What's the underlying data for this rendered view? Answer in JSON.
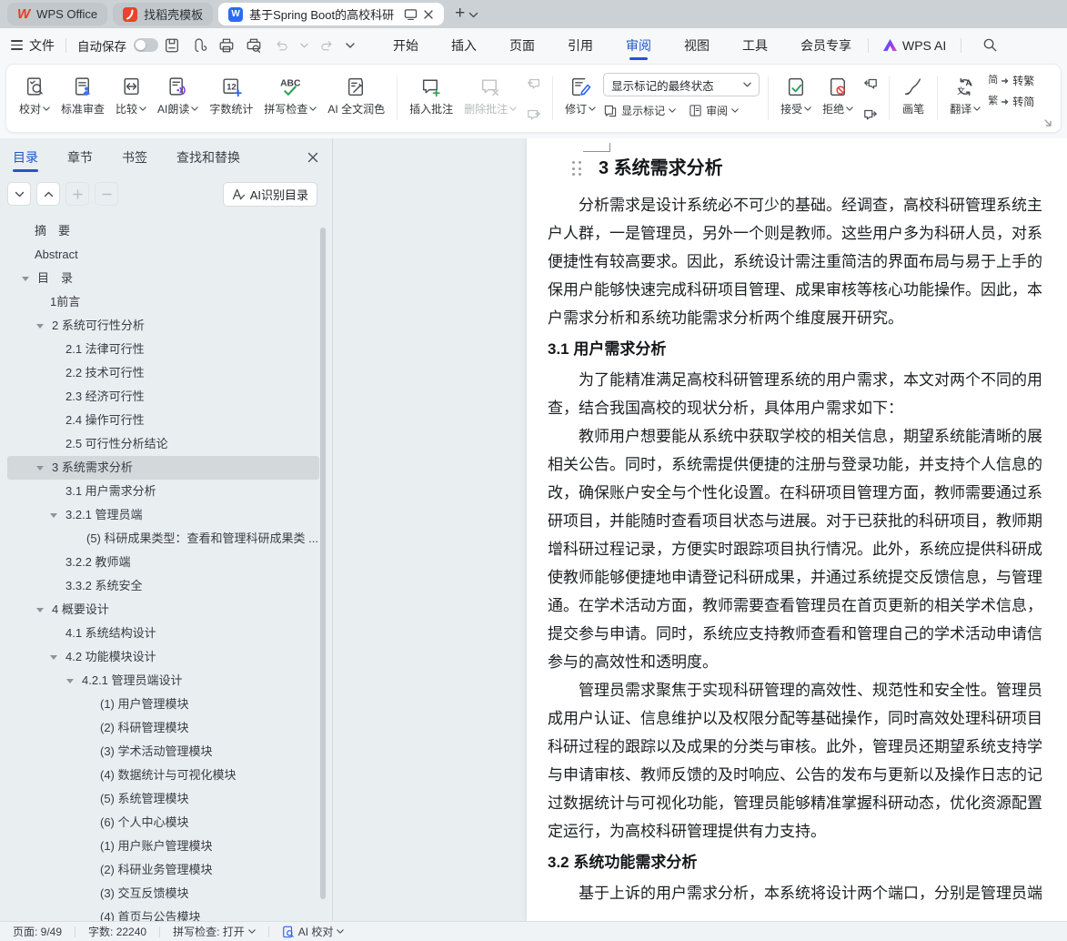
{
  "tabbar": {
    "tabs": [
      {
        "label": "WPS Office"
      },
      {
        "label": "找稻壳模板"
      },
      {
        "label": "基于Spring Boot的高校科研"
      }
    ]
  },
  "menubar": {
    "file": "文件",
    "autosave": "自动保存",
    "tabs": [
      "开始",
      "插入",
      "页面",
      "引用",
      "审阅",
      "视图",
      "工具",
      "会员专享"
    ],
    "active_tab": "审阅",
    "wps_ai": "WPS AI"
  },
  "ribbon": {
    "proofread": "校对",
    "std_review": "标准审查",
    "compare": "比较",
    "ai_read": "AI朗读",
    "word_count": "字数统计",
    "spell_check": "拼写检查",
    "ai_polish": "AI 全文润色",
    "insert_comment": "插入批注",
    "delete_comment": "删除批注",
    "revise": "修订",
    "markup_state": "显示标记的最终状态",
    "show_markup": "显示标记",
    "review": "审阅",
    "accept": "接受",
    "reject": "拒绝",
    "brush": "画笔",
    "translate": "翻译",
    "to_trad": "转繁",
    "to_simp": "转简",
    "to_trad_glyph": "简",
    "to_simp_glyph": "繁"
  },
  "sidebar": {
    "tabs": [
      "目录",
      "章节",
      "书签",
      "查找和替换"
    ],
    "active_tab": "目录",
    "ai_recognize": "AI识别目录",
    "outline": [
      {
        "t": "摘　要",
        "indent": 38
      },
      {
        "t": "Abstract",
        "indent": 38
      },
      {
        "t": "目　录",
        "indent": 41,
        "arrow": true
      },
      {
        "t": "1前言",
        "indent": 55
      },
      {
        "t": "2 系统可行性分析",
        "indent": 57,
        "arrow": true
      },
      {
        "t": "2.1 法律可行性",
        "indent": 72
      },
      {
        "t": "2.2 技术可行性",
        "indent": 72
      },
      {
        "t": "2.3 经济可行性",
        "indent": 72
      },
      {
        "t": "2.4 操作可行性",
        "indent": 72
      },
      {
        "t": "2.5 可行性分析结论",
        "indent": 72
      },
      {
        "t": "3 系统需求分析",
        "indent": 57,
        "arrow": true,
        "sel": true
      },
      {
        "t": "3.1 用户需求分析",
        "indent": 72
      },
      {
        "t": "3.2.1 管理员端",
        "indent": 72,
        "arrow": true
      },
      {
        "t": "(5) 科研成果类型：查看和管理科研成果类 ...",
        "indent": 95
      },
      {
        "t": "3.2.2 教师端",
        "indent": 72
      },
      {
        "t": "3.3.2 系统安全",
        "indent": 72
      },
      {
        "t": "4 概要设计",
        "indent": 57,
        "arrow": true
      },
      {
        "t": "4.1 系统结构设计",
        "indent": 72
      },
      {
        "t": "4.2 功能模块设计",
        "indent": 72,
        "arrow": true
      },
      {
        "t": "4.2.1 管理员端设计",
        "indent": 90,
        "arrow": true
      },
      {
        "t": "(1) 用户管理模块",
        "indent": 110
      },
      {
        "t": "(2) 科研管理模块",
        "indent": 110
      },
      {
        "t": "(3) 学术活动管理模块",
        "indent": 110
      },
      {
        "t": "(4) 数据统计与可视化模块",
        "indent": 110
      },
      {
        "t": "(5) 系统管理模块",
        "indent": 110
      },
      {
        "t": "(6) 个人中心模块",
        "indent": 110
      },
      {
        "t": "(1) 用户账户管理模块",
        "indent": 110
      },
      {
        "t": "(2) 科研业务管理模块",
        "indent": 110
      },
      {
        "t": "(3) 交互反馈模块",
        "indent": 110
      },
      {
        "t": "(4) 首页与公告模块",
        "indent": 110
      }
    ]
  },
  "document": {
    "lines": [
      {
        "type": "h1",
        "text": "3 系统需求分析"
      },
      {
        "type": "p1",
        "text": "分析需求是设计系统必不可少的基础。经调查，高校科研管理系统主"
      },
      {
        "type": "p",
        "text": "户人群，一是管理员，另外一个则是教师。这些用户多为科研人员，对系"
      },
      {
        "type": "p",
        "text": "便捷性有较高要求。因此，系统设计需注重简洁的界面布局与易于上手的"
      },
      {
        "type": "p",
        "text": "保用户能够快速完成科研项目管理、成果审核等核心功能操作。因此，本"
      },
      {
        "type": "p",
        "text": "户需求分析和系统功能需求分析两个维度展开研究。"
      },
      {
        "type": "h2",
        "text": "3.1 用户需求分析"
      },
      {
        "type": "p1",
        "text": "为了能精准满足高校科研管理系统的用户需求，本文对两个不同的用"
      },
      {
        "type": "p",
        "text": "查，结合我国高校的现状分析，具体用户需求如下："
      },
      {
        "type": "p1",
        "text": "教师用户想要能从系统中获取学校的相关信息，期望系统能清晰的展"
      },
      {
        "type": "p",
        "text": "相关公告。同时，系统需提供便捷的注册与登录功能，并支持个人信息的"
      },
      {
        "type": "p",
        "text": "改，确保账户安全与个性化设置。在科研项目管理方面，教师需要通过系"
      },
      {
        "type": "p",
        "text": "研项目，并能随时查看项目状态与进展。对于已获批的科研项目，教师期"
      },
      {
        "type": "p",
        "text": "增科研过程记录，方便实时跟踪项目执行情况。此外，系统应提供科研成"
      },
      {
        "type": "p",
        "text": "使教师能够便捷地申请登记科研成果，并通过系统提交反馈信息，与管理"
      },
      {
        "type": "p",
        "text": "通。在学术活动方面，教师需要查看管理员在首页更新的相关学术信息，"
      },
      {
        "type": "p",
        "text": "提交参与申请。同时，系统应支持教师查看和管理自己的学术活动申请信"
      },
      {
        "type": "p",
        "text": "参与的高效性和透明度。"
      },
      {
        "type": "p1",
        "text": "管理员需求聚焦于实现科研管理的高效性、规范性和安全性。管理员"
      },
      {
        "type": "p",
        "text": "成用户认证、信息维护以及权限分配等基础操作，同时高效处理科研项目"
      },
      {
        "type": "p",
        "text": "科研过程的跟踪以及成果的分类与审核。此外，管理员还期望系统支持学"
      },
      {
        "type": "p",
        "text": "与申请审核、教师反馈的及时响应、公告的发布与更新以及操作日志的记"
      },
      {
        "type": "p",
        "text": "过数据统计与可视化功能，管理员能够精准掌握科研动态，优化资源配置"
      },
      {
        "type": "p",
        "text": "定运行，为高校科研管理提供有力支持。"
      },
      {
        "type": "h2",
        "text": "3.2 系统功能需求分析"
      },
      {
        "type": "p1",
        "text": "基于上诉的用户需求分析，本系统将设计两个端口，分别是管理员端"
      }
    ]
  },
  "statusbar": {
    "page": "页面: 9/49",
    "words": "字数: 22240",
    "spell": "拼写检查: 打开",
    "ai_proof": "AI 校对"
  }
}
